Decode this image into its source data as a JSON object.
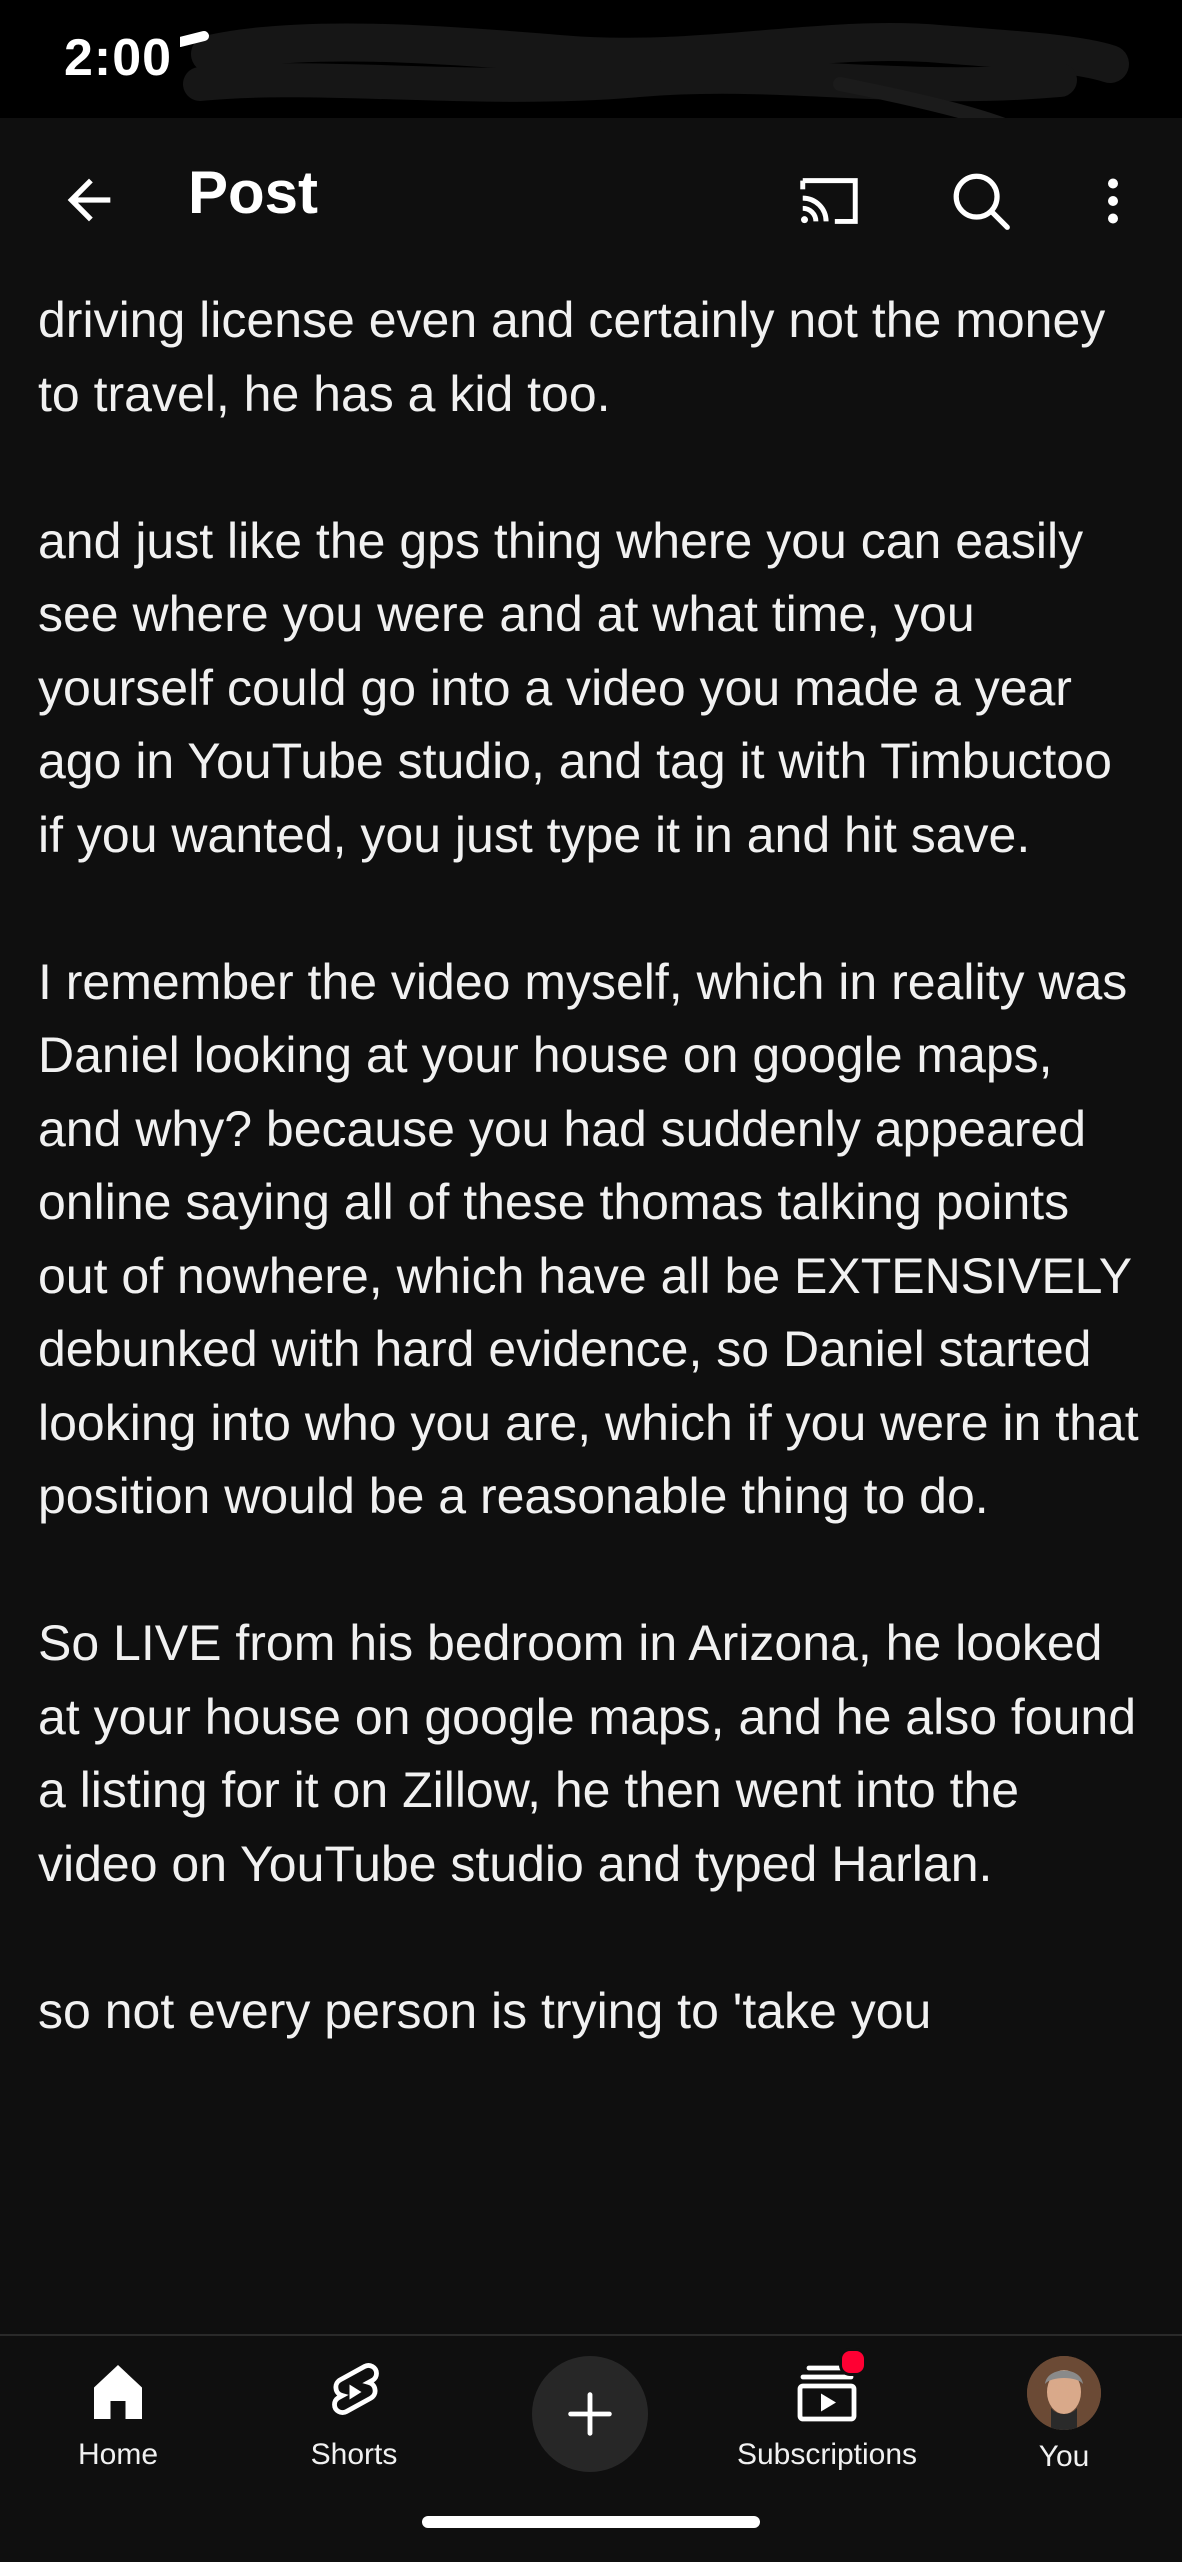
{
  "status_bar": {
    "time": "2:00"
  },
  "app_bar": {
    "title": "Post",
    "icons": [
      "back-arrow-icon",
      "cast-icon",
      "search-icon",
      "more-vert-icon"
    ]
  },
  "post": {
    "paragraphs": [
      "driving license even and certainly not the money to travel, he has a kid too.",
      "and just like the gps thing where you can easily see where you were and at what time, you yourself could go into a video you made a year ago in YouTube studio, and tag it with Timbuctoo if you wanted, you just type it in and hit save.",
      "I remember the video myself, which in reality was Daniel looking at your house on google maps, and why? because you had suddenly appeared online saying all of these thomas talking points out of nowhere, which have all be EXTENSIVELY debunked with hard evidence, so Daniel started looking into who you are, which if you were in that position would be a reasonable thing to do.",
      "So LIVE from his bedroom in Arizona, he looked at your house on google maps, and he also found a listing for it on Zillow, he then went into the video on YouTube studio and typed Harlan.",
      "so not every person is trying to 'take you"
    ]
  },
  "bottom_nav": {
    "items": [
      {
        "label": "Home",
        "icon": "home-icon"
      },
      {
        "label": "Shorts",
        "icon": "shorts-icon"
      },
      {
        "label": "",
        "icon": "create-plus-icon"
      },
      {
        "label": "Subscriptions",
        "icon": "subscriptions-icon"
      },
      {
        "label": "You",
        "icon": "avatar"
      }
    ]
  },
  "colors": {
    "background": "#0f0f0f",
    "text": "#f1f1f1",
    "notification": "#ff0033"
  }
}
